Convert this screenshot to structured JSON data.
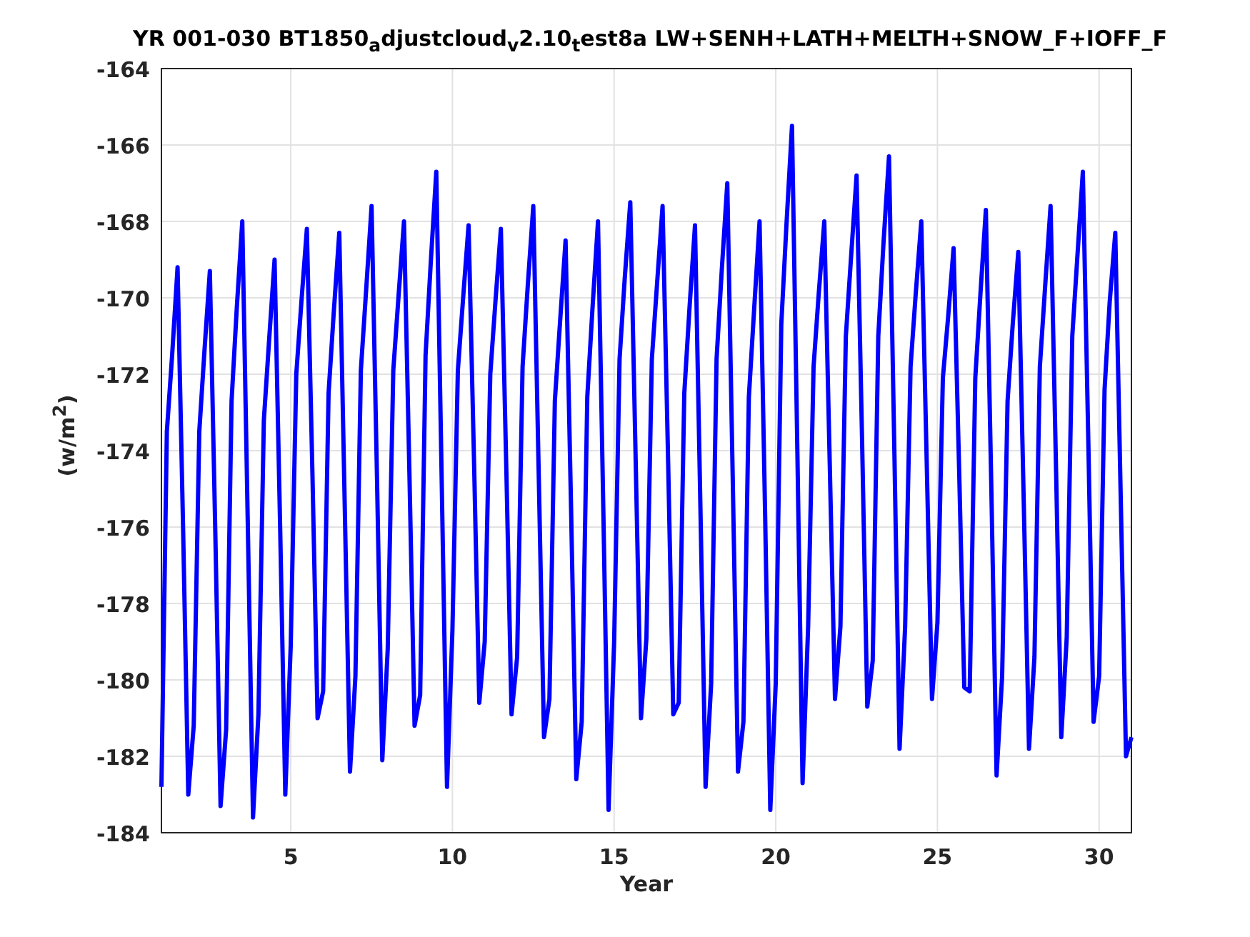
{
  "figure": {
    "title": "YR 001-030 BT1850$_{a}$djustcloud$_{v}$2.10$_{t}$est8a LW+SENH+LATH+MELTH+SNOW_F+IOFF_F",
    "chart_data": {
      "type": "line",
      "grid": true,
      "xlabel": "Year",
      "ylabel": "(w/m$^{2}$)",
      "xlim": [
        1,
        31
      ],
      "ylim": [
        -184,
        -164
      ],
      "xticks": [
        5,
        10,
        15,
        20,
        25,
        30
      ],
      "yticks": [
        -184,
        -182,
        -180,
        -178,
        -176,
        -174,
        -172,
        -170,
        -168,
        -166,
        -164
      ],
      "x": [
        1,
        1.17,
        1.33,
        1.5,
        1.67,
        1.83,
        2,
        2.17,
        2.33,
        2.5,
        2.67,
        2.83,
        3,
        3.17,
        3.33,
        3.5,
        3.67,
        3.83,
        4,
        4.17,
        4.33,
        4.5,
        4.67,
        4.83,
        5,
        5.17,
        5.33,
        5.5,
        5.67,
        5.83,
        6,
        6.17,
        6.33,
        6.5,
        6.67,
        6.83,
        7,
        7.17,
        7.33,
        7.5,
        7.67,
        7.83,
        8,
        8.17,
        8.33,
        8.5,
        8.67,
        8.83,
        9,
        9.17,
        9.33,
        9.5,
        9.67,
        9.83,
        10,
        10.17,
        10.33,
        10.5,
        10.67,
        10.83,
        11,
        11.17,
        11.33,
        11.5,
        11.67,
        11.83,
        12,
        12.17,
        12.33,
        12.5,
        12.67,
        12.83,
        13,
        13.17,
        13.33,
        13.5,
        13.67,
        13.83,
        14,
        14.17,
        14.33,
        14.5,
        14.67,
        14.83,
        15,
        15.17,
        15.33,
        15.5,
        15.67,
        15.83,
        16,
        16.17,
        16.33,
        16.5,
        16.67,
        16.83,
        17,
        17.17,
        17.33,
        17.5,
        17.67,
        17.83,
        18,
        18.17,
        18.33,
        18.5,
        18.67,
        18.83,
        19,
        19.17,
        19.33,
        19.5,
        19.67,
        19.83,
        20,
        20.17,
        20.33,
        20.5,
        20.67,
        20.83,
        21,
        21.17,
        21.33,
        21.5,
        21.67,
        21.83,
        22,
        22.17,
        22.33,
        22.5,
        22.67,
        22.83,
        23,
        23.17,
        23.33,
        23.5,
        23.67,
        23.83,
        24,
        24.17,
        24.33,
        24.5,
        24.67,
        24.83,
        25,
        25.17,
        25.33,
        25.5,
        25.67,
        25.83,
        26,
        26.17,
        26.33,
        26.5,
        26.67,
        26.83,
        27,
        27.17,
        27.33,
        27.5,
        27.67,
        27.83,
        28,
        28.17,
        28.33,
        28.5,
        28.67,
        28.83,
        29,
        29.17,
        29.33,
        29.5,
        29.67,
        29.83,
        30,
        30.17,
        30.33,
        30.5,
        30.67,
        30.83,
        31
      ],
      "series": [
        {
          "color": "#0000ff",
          "values": [
            -182.8,
            -173.5,
            -171.5,
            -169.2,
            -176.1,
            -183.0,
            -181.2,
            -173.5,
            -171.4,
            -169.3,
            -176.3,
            -183.3,
            -181.3,
            -172.7,
            -170.3,
            -168.0,
            -175.8,
            -183.6,
            -180.9,
            -173.2,
            -171.1,
            -169.0,
            -176.0,
            -183.0,
            -179.1,
            -172.0,
            -170.1,
            -168.2,
            -174.6,
            -181.0,
            -180.3,
            -172.5,
            -170.4,
            -168.3,
            -175.4,
            -182.4,
            -179.9,
            -171.9,
            -169.8,
            -167.6,
            -174.9,
            -182.1,
            -179.2,
            -171.9,
            -170.0,
            -168.0,
            -174.6,
            -181.2,
            -180.4,
            -171.5,
            -169.1,
            -166.7,
            -174.8,
            -182.8,
            -178.7,
            -171.9,
            -170.0,
            -168.1,
            -174.4,
            -180.6,
            -179.0,
            -172.0,
            -170.1,
            -168.2,
            -174.6,
            -180.9,
            -179.4,
            -171.8,
            -169.7,
            -167.6,
            -174.6,
            -181.5,
            -180.5,
            -172.7,
            -170.6,
            -168.5,
            -175.6,
            -182.6,
            -181.1,
            -172.6,
            -170.3,
            -168.0,
            -175.7,
            -183.4,
            -179.0,
            -171.6,
            -169.5,
            -167.5,
            -174.3,
            -181.0,
            -178.9,
            -171.6,
            -169.6,
            -167.6,
            -174.3,
            -180.9,
            -180.6,
            -172.5,
            -170.3,
            -168.1,
            -175.5,
            -182.8,
            -180.1,
            -171.6,
            -169.3,
            -167.0,
            -174.7,
            -182.4,
            -181.1,
            -172.6,
            -170.3,
            -168.0,
            -175.7,
            -183.4,
            -180.1,
            -170.7,
            -168.1,
            -165.5,
            -174.1,
            -182.7,
            -178.6,
            -171.8,
            -169.9,
            -168.0,
            -174.3,
            -180.5,
            -178.6,
            -171.0,
            -168.9,
            -166.8,
            -173.8,
            -180.7,
            -179.5,
            -171.0,
            -168.6,
            -166.3,
            -174.1,
            -181.8,
            -178.6,
            -171.8,
            -169.9,
            -168.0,
            -174.3,
            -180.5,
            -178.5,
            -172.1,
            -170.5,
            -168.7,
            -174.5,
            -180.2,
            -180.3,
            -172.1,
            -169.9,
            -167.7,
            -175.1,
            -182.5,
            -179.9,
            -172.7,
            -170.7,
            -168.8,
            -175.3,
            -181.8,
            -179.4,
            -171.8,
            -169.7,
            -167.6,
            -174.6,
            -181.5,
            -178.9,
            -171.0,
            -168.9,
            -166.7,
            -173.9,
            -181.1,
            -179.9,
            -172.4,
            -170.1,
            -168.3,
            -175.2,
            -182.0,
            -181.5
          ]
        }
      ]
    }
  }
}
